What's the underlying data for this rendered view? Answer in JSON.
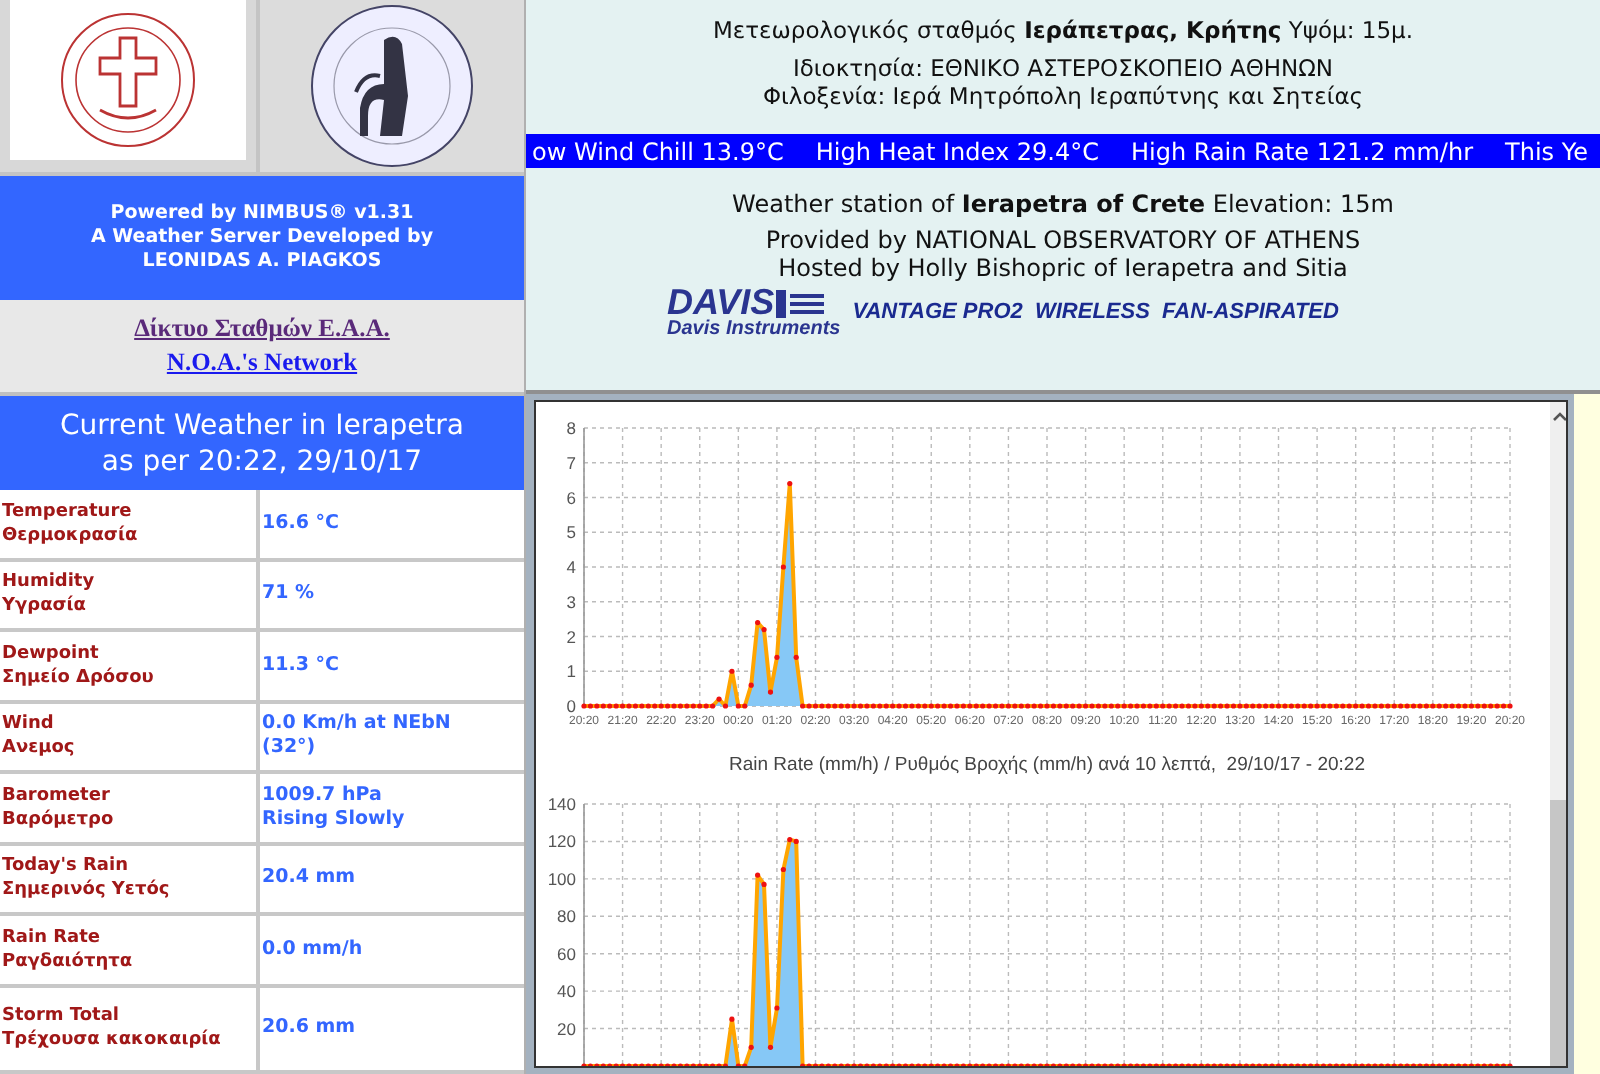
{
  "logos": [
    {
      "kind": "cross"
    },
    {
      "kind": "observatory"
    }
  ],
  "credits": {
    "lines": [
      "Powered by NIMBUS® v1.31",
      "A Weather Server Developed by",
      "LEONIDAS A. PIAGKOS"
    ]
  },
  "network_links": [
    {
      "label": "Δίκτυο Σταθμών Ε.Α.Α.",
      "kind": "greek"
    },
    {
      "label": "N.O.A.'s Network",
      "kind": "english"
    }
  ],
  "station_gr": {
    "title": "Μετεωρολογικός σταθμός **Ιεράπετρας, Κρήτης** Υψόμ: 15μ.",
    "lines": [
      "Ιδιοκτησία: ΕΘΝΙΚΟ ΑΣΤΕΡΟΣΚΟΠΕΙΟ ΑΘΗΝΩΝ",
      "Φιλοξενία: Ιερά Μητρόπολη Ιεραπύτνης και Σητείας"
    ]
  },
  "ticker": [
    "ow Wind Chill 13.9°C",
    "High Heat Index 29.4°C",
    "High Rain Rate 121.2 mm/hr",
    "This Ye"
  ],
  "station_en": {
    "title": "Weather station of **Ierapetra of Crete** Elevation: 15m",
    "lines": [
      "Provided by NATIONAL OBSERVATORY OF ATHENS",
      "Hosted by Holly Bishopric of Ierapetra and Sitia"
    ]
  },
  "davis": {
    "logo": "DAVIS",
    "sub": "Davis Instruments",
    "model": "VANTAGE PRO2  WIRELESS  FAN-ASPIRATED"
  },
  "current": {
    "title": "Current Weather in Ierapetra",
    "subtitle": "as per 20:22, 29/10/17",
    "rows": [
      {
        "label": "Temperature",
        "label_gr": "Θερμοκρασία",
        "value": [
          "16.6 °C"
        ]
      },
      {
        "label": "Humidity",
        "label_gr": "Υγρασία",
        "value": [
          "71 %"
        ]
      },
      {
        "label": "Dewpoint",
        "label_gr": "Σημείο Δρόσου",
        "value": [
          "11.3 °C"
        ]
      },
      {
        "label": "Wind",
        "label_gr": "Ανεμος",
        "value": [
          "0.0 Km/h at NEbN",
          "(32°)"
        ]
      },
      {
        "label": "Barometer",
        "label_gr": "Βαρόμετρο",
        "value": [
          "1009.7 hPa",
          "Rising Slowly"
        ]
      },
      {
        "label": "Today's Rain",
        "label_gr": "Σημερινός Υετός",
        "value": [
          "20.4 mm"
        ]
      },
      {
        "label": "Rain Rate",
        "label_gr": "Ραγδαιότητα",
        "value": [
          "0.0 mm/h"
        ]
      },
      {
        "label": "Storm Total",
        "label_gr": "Τρέχουσα κακοκαιρία",
        "value": [
          "20.6 mm"
        ]
      }
    ]
  },
  "charts": [
    {
      "chart_data": {
        "type": "area",
        "grid": true,
        "ylim": [
          0,
          8
        ],
        "yticks": [
          0,
          1,
          2,
          3,
          4,
          5,
          6,
          7,
          8
        ],
        "categories": [
          "20:20",
          null,
          null,
          null,
          null,
          null,
          "21:20",
          null,
          null,
          null,
          null,
          null,
          "22:20",
          null,
          null,
          null,
          null,
          null,
          "23:20",
          null,
          null,
          null,
          null,
          null,
          "00:20",
          null,
          null,
          null,
          null,
          null,
          "01:20",
          null,
          null,
          null,
          null,
          null,
          "02:20",
          null,
          null,
          null,
          null,
          null,
          "03:20",
          null,
          null,
          null,
          null,
          null,
          "04:20",
          null,
          null,
          null,
          null,
          null,
          "05:20",
          null,
          null,
          null,
          null,
          null,
          "06:20",
          null,
          null,
          null,
          null,
          null,
          "07:20",
          null,
          null,
          null,
          null,
          null,
          "08:20",
          null,
          null,
          null,
          null,
          null,
          "09:20",
          null,
          null,
          null,
          null,
          null,
          "10:20",
          null,
          null,
          null,
          null,
          null,
          "11:20",
          null,
          null,
          null,
          null,
          null,
          "12:20",
          null,
          null,
          null,
          null,
          null,
          "13:20",
          null,
          null,
          null,
          null,
          null,
          "14:20",
          null,
          null,
          null,
          null,
          null,
          "15:20",
          null,
          null,
          null,
          null,
          null,
          "16:20",
          null,
          null,
          null,
          null,
          null,
          "17:20",
          null,
          null,
          null,
          null,
          null,
          "18:20",
          null,
          null,
          null,
          null,
          null,
          "19:20",
          null,
          null,
          null,
          null,
          null,
          "20:20"
        ],
        "series": [
          {
            "color": "#86c8f6",
            "values": [
              0,
              0,
              0,
              0,
              0,
              0,
              0,
              0,
              0,
              0,
              0,
              0,
              0,
              0,
              0,
              0,
              0,
              0,
              0,
              0,
              0,
              0.2,
              0,
              1.0,
              0,
              0,
              0.6,
              2.4,
              2.2,
              0.4,
              1.4,
              4.0,
              6.4,
              1.4,
              0,
              0,
              0,
              0,
              0,
              0,
              0,
              0,
              0,
              0,
              0,
              0,
              0,
              0,
              0,
              0,
              0,
              0,
              0,
              0,
              0,
              0,
              0,
              0,
              0,
              0,
              0,
              0,
              0,
              0,
              0,
              0,
              0,
              0,
              0,
              0,
              0,
              0,
              0,
              0,
              0,
              0,
              0,
              0,
              0,
              0,
              0,
              0,
              0,
              0,
              0,
              0,
              0,
              0,
              0,
              0,
              0,
              0,
              0,
              0,
              0,
              0,
              0,
              0,
              0,
              0,
              0,
              0,
              0,
              0,
              0,
              0,
              0,
              0,
              0,
              0,
              0,
              0,
              0,
              0,
              0,
              0,
              0,
              0,
              0,
              0,
              0,
              0,
              0,
              0,
              0,
              0,
              0,
              0,
              0,
              0,
              0,
              0,
              0,
              0,
              0,
              0,
              0,
              0,
              0,
              0,
              0,
              0,
              0,
              0,
              0
            ]
          }
        ]
      }
    },
    {
      "chart_data": {
        "type": "area",
        "title": "Rain Rate (mm/h) / Ρυθμός Βροχής (mm/h) ανά 10 λεπτά,  29/10/17 - 20:22",
        "ylim": [
          0,
          140
        ],
        "grid": true,
        "yticks": [
          20,
          40,
          60,
          80,
          100,
          120,
          140
        ],
        "series": [
          {
            "color": "#86c8f6",
            "values": [
              0,
              0,
              0,
              0,
              0,
              0,
              0,
              0,
              0,
              0,
              0,
              0,
              0,
              0,
              0,
              0,
              0,
              0,
              0,
              0,
              0,
              0,
              0,
              25,
              0,
              0,
              10,
              102,
              97,
              10,
              31,
              105,
              121,
              120,
              0,
              0,
              0,
              0,
              0,
              0,
              0,
              0,
              0,
              0,
              0,
              0,
              0,
              0,
              0,
              0,
              0,
              0,
              0,
              0,
              0,
              0,
              0,
              0,
              0,
              0,
              0,
              0,
              0,
              0,
              0,
              0,
              0,
              0,
              0,
              0,
              0,
              0,
              0,
              0,
              0,
              0,
              0,
              0,
              0,
              0,
              0,
              0,
              0,
              0,
              0,
              0,
              0,
              0,
              0,
              0,
              0,
              0,
              0,
              0,
              0,
              0,
              0,
              0,
              0,
              0,
              0,
              0,
              0,
              0,
              0,
              0,
              0,
              0,
              0,
              0,
              0,
              0,
              0,
              0,
              0,
              0,
              0,
              0,
              0,
              0,
              0,
              0,
              0,
              0,
              0,
              0,
              0,
              0,
              0,
              0,
              0,
              0,
              0,
              0,
              0,
              0,
              0,
              0,
              0,
              0,
              0,
              0,
              0,
              0,
              0
            ]
          }
        ]
      }
    }
  ]
}
